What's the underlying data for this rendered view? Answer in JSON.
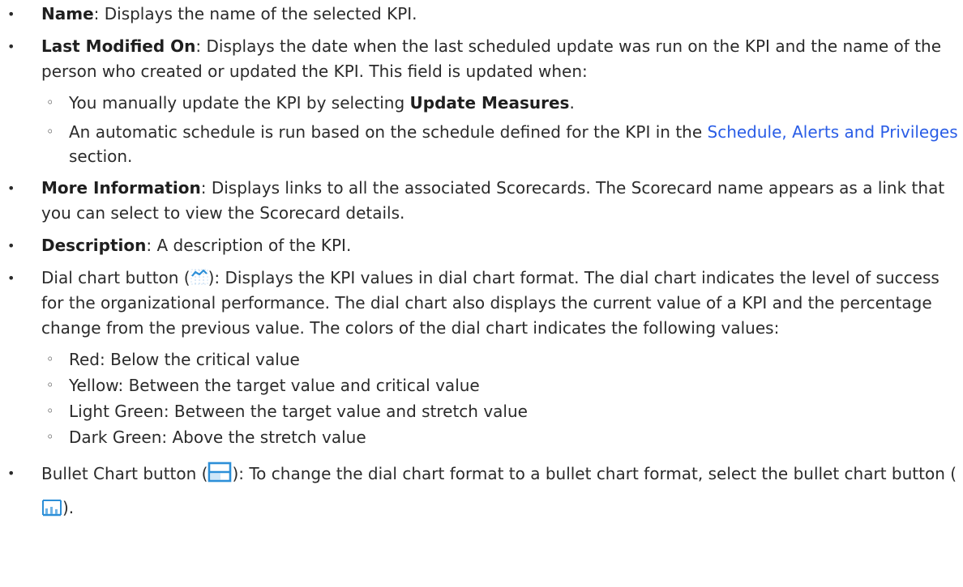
{
  "items": {
    "name": {
      "term": "Name",
      "text": ": Displays the name of the selected KPI."
    },
    "last_modified": {
      "term": "Last Modified On",
      "text": ": Displays the date when the last scheduled update was run on the KPI and the name of the person who created or updated the KPI. This field is updated when:",
      "sub": {
        "manual_pre": "You manually update the KPI by selecting ",
        "manual_bold": "Update Measures",
        "manual_post": ".",
        "auto_pre": "An automatic schedule is run based on the schedule defined for the KPI in the ",
        "auto_link": "Schedule, Alerts and Privileges",
        "auto_post": " section."
      }
    },
    "more_info": {
      "term": "More Information",
      "text": ": Displays links to all the associated Scorecards. The Scorecard name appears as a link that you can select to view the Scorecard details."
    },
    "description": {
      "term": "Description",
      "text": ": A description of the KPI."
    },
    "dial_chart": {
      "pre": "Dial chart button (",
      "text": "): Displays the KPI values in dial chart format. The dial chart indicates the level of success for the organizational performance. The dial chart also displays the current value of a KPI and the percentage change from the previous value. The colors of the dial chart indicates the following values:",
      "values": [
        "Red: Below the critical value",
        "Yellow: Between the target value and critical value",
        "Light Green: Between the target value and stretch value",
        "Dark Green: Above the stretch value"
      ]
    },
    "bullet_chart": {
      "pre": "Bullet Chart button (",
      "text": "): To change the dial chart format to a bullet chart format, select the bullet chart button (",
      "post": ")."
    }
  },
  "colors": {
    "text": "#2b2b2b",
    "link": "#2a5de6",
    "icon_blue": "#2c8fd8"
  },
  "icons": [
    "dial-chart-icon",
    "bullet-chart-icon",
    "bullet-chart-small-icon"
  ]
}
